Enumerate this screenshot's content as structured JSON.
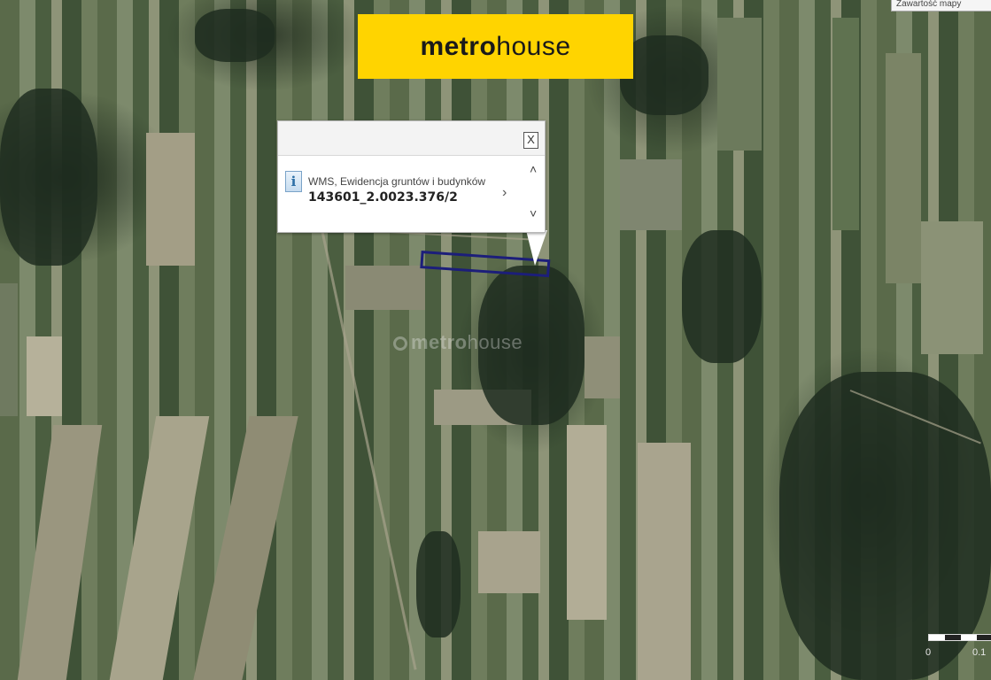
{
  "branding": {
    "logo_bold": "metro",
    "logo_light": "house",
    "banner_color": "#ffd400",
    "watermark_bold": "metro",
    "watermark_light": "house"
  },
  "popup": {
    "layer_name": "WMS, Ewidencja gruntów i budynków",
    "parcel_id": "143601_2.0023.376/2",
    "close_glyph": "X",
    "info_glyph": "i",
    "next_glyph": "›",
    "scroll_up_glyph": "˄",
    "scroll_down_glyph": "˅"
  },
  "map_tab": {
    "label": "Zawartość mapy"
  },
  "scale": {
    "start_label": "0",
    "end_label": "0.1"
  },
  "parcel": {
    "outline_color": "#1c1e7a"
  }
}
